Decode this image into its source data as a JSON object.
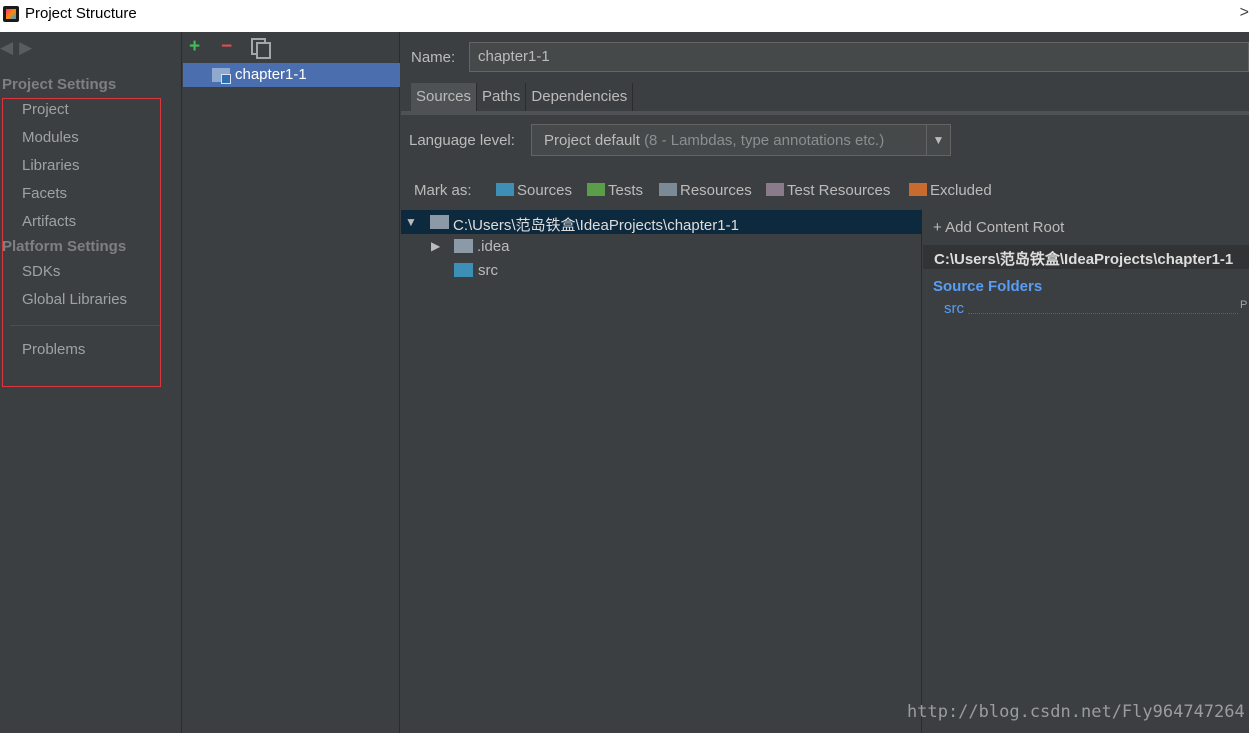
{
  "window": {
    "title": "Project Structure",
    "close_glyph": ">"
  },
  "nav": {
    "back_icon": "◀",
    "forward_icon": "▶",
    "project_settings": "Project Settings",
    "project_items": [
      "Project",
      "Modules",
      "Libraries",
      "Facets",
      "Artifacts"
    ],
    "platform_settings": "Platform Settings",
    "platform_items": [
      "SDKs",
      "Global Libraries"
    ],
    "problems": "Problems"
  },
  "modules": {
    "add_icon": "+",
    "remove_icon": "−",
    "items": [
      "chapter1-1"
    ]
  },
  "main": {
    "name_label": "Name:",
    "name_value": "chapter1-1",
    "tabs": [
      "Sources",
      "Paths",
      "Dependencies"
    ],
    "language_label": "Language level:",
    "language_value": "Project default",
    "language_detail": "(8 - Lambdas, type annotations etc.)",
    "mark_as_label": "Mark as:",
    "mark_as": [
      {
        "label": "Sources",
        "color": "#3d8fb5"
      },
      {
        "label": "Tests",
        "color": "#5a9e4a"
      },
      {
        "label": "Resources",
        "color": "#7a8a96"
      },
      {
        "label": "Test Resources",
        "color": "#8a7a8a"
      },
      {
        "label": "Excluded",
        "color": "#c96a2f"
      }
    ]
  },
  "tree": {
    "root": "C:\\Users\\范岛铁盒\\IdeaProjects\\chapter1-1",
    "children": [
      ".idea",
      "src"
    ]
  },
  "content_root": {
    "add_label": "+ Add Content Root",
    "path": "C:\\Users\\范岛铁盒\\IdeaProjects\\chapter1-1",
    "source_folders_title": "Source Folders",
    "source_folders": [
      "src"
    ],
    "properties_glyph": "P"
  },
  "watermark": "http://blog.csdn.net/Fly964747264"
}
